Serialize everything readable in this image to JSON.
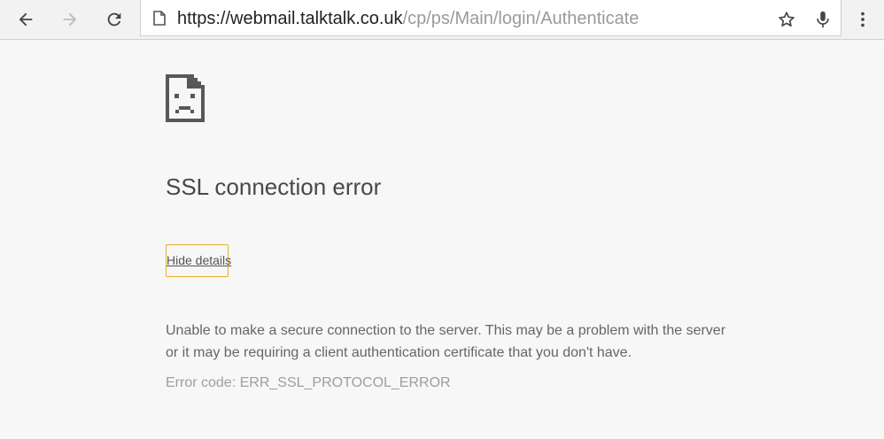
{
  "browser": {
    "url": {
      "scheme": "https://",
      "host": "webmail.talktalk.co.uk",
      "path": "/cp/ps/Main/login/Authenticate"
    },
    "icons": {
      "back": "arrow-left-icon",
      "forward": "arrow-right-icon",
      "reload": "reload-icon",
      "page_info": "page-icon",
      "bookmark": "star-icon",
      "voice": "microphone-icon",
      "menu": "kebab-menu-icon"
    },
    "forward_disabled": true
  },
  "error_page": {
    "icon": "sad-page-icon",
    "title": "SSL connection error",
    "details_button": "Hide details",
    "explanation_line1": "Unable to make a secure connection to the server. This may be a problem with the server",
    "explanation_line2": "or it may be requiring a client authentication certificate that you don't have.",
    "error_code": "Error code: ERR_SSL_PROTOCOL_ERROR"
  },
  "colors": {
    "page_background": "#f7f7f7",
    "title": "#484848",
    "body_text": "#666666",
    "error_code": "#9e9e9e",
    "focus_ring": "#e3b12b"
  }
}
